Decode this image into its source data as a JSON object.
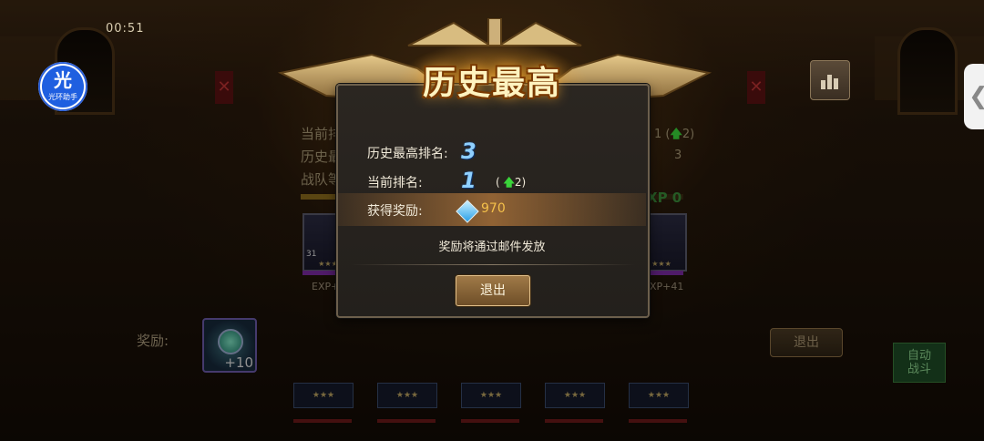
{
  "timer": "00:51",
  "helper": {
    "icon_char": "光",
    "label": "光环助手"
  },
  "side_tab": {
    "icon_char": "❮"
  },
  "background": {
    "info_lines": [
      "当前排",
      "历史最",
      "战队等"
    ],
    "right_rank": "1",
    "right_delta": "2",
    "right_best": "3",
    "exp_tag": "XP 0",
    "exp_left": "EXP+4",
    "exp_right": "EXP+41",
    "hero_level": "31",
    "reward_label": "奖励:",
    "reward_qty": "+10",
    "exit_label": "退出",
    "auto_label_line1": "自动",
    "auto_label_line2": "战斗"
  },
  "dialog": {
    "title": "历史最高",
    "best_rank_label": "历史最高排名:",
    "best_rank_value": "3",
    "current_rank_label": "当前排名:",
    "current_rank_value": "1",
    "current_rank_delta": "2",
    "reward_label": "获得奖励:",
    "reward_icon": "diamond-icon",
    "reward_value": "970",
    "mail_note": "奖励将通过邮件发放",
    "exit_label": "退出"
  },
  "colors": {
    "rank_number": "#8fd0ff",
    "reward_value": "#f4c04a",
    "up_arrow": "#3ad43a"
  }
}
